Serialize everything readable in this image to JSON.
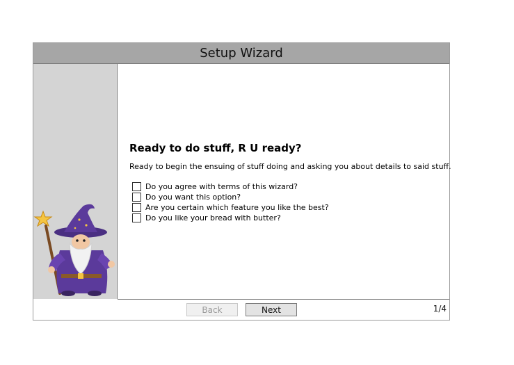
{
  "window": {
    "title": "Setup Wizard"
  },
  "page": {
    "heading": "Ready to do stuff, R U ready?",
    "description": "Ready to begin the ensuing of stuff doing and asking you about details to said stuff.",
    "options": [
      {
        "label": "Do you agree with terms of this wizard?",
        "checked": false
      },
      {
        "label": "Do you want this option?",
        "checked": false
      },
      {
        "label": "Are you certain which feature you like the best?",
        "checked": false
      },
      {
        "label": "Do you like your bread with butter?",
        "checked": false
      }
    ]
  },
  "footer": {
    "back_label": "Back",
    "next_label": "Next",
    "page_indicator": "1/4"
  },
  "sidebar": {
    "image": "wizard-illustration-icon"
  },
  "colors": {
    "titlebar": "#a6a6a6",
    "sidebar": "#d4d4d4",
    "robe": "#5b3a9b",
    "beard": "#f2f2f2"
  }
}
